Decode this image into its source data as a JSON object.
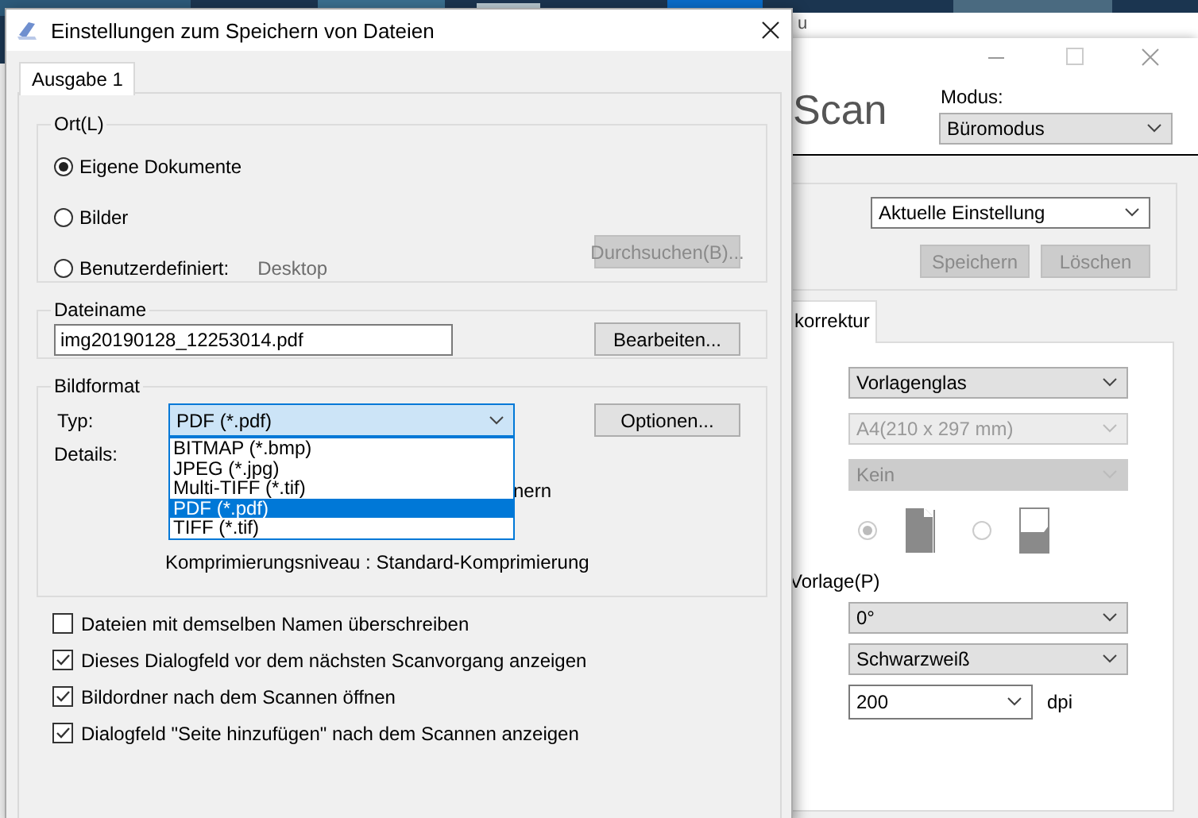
{
  "background_window": {
    "title": "u"
  },
  "dialog": {
    "title": "Einstellungen zum Speichern von Dateien",
    "tabs": [
      {
        "label": "Ausgabe 1",
        "selected": true
      }
    ],
    "location": {
      "legend": "Ort(L)",
      "options": [
        {
          "label": "Eigene Dokumente",
          "selected": true
        },
        {
          "label": "Bilder",
          "selected": false
        },
        {
          "label": "Benutzerdefiniert:",
          "selected": false,
          "value": "Desktop"
        }
      ],
      "browse_button": {
        "label": "Durchsuchen(B)...",
        "disabled": true
      }
    },
    "filename": {
      "legend": "Dateiname",
      "value": "img20190128_12253014.pdf",
      "edit_button": "Bearbeiten..."
    },
    "image_format": {
      "legend": "Bildformat",
      "type_label": "Typ:",
      "type_value": "PDF (*.pdf)",
      "options_button": "Optionen...",
      "details_label": "Details:",
      "dropdown_items": [
        {
          "label": "BITMAP (*.bmp)",
          "selected": false
        },
        {
          "label": "JPEG (*.jpg)",
          "selected": false
        },
        {
          "label": "Multi-TIFF (*.tif)",
          "selected": false
        },
        {
          "label": "PDF (*.pdf)",
          "selected": true
        },
        {
          "label": "TIFF (*.tif)",
          "selected": false
        }
      ],
      "details_lines": [
        "nern",
        "Komprimierungsniveau : Standard-Komprimierung"
      ]
    },
    "checkboxes": [
      {
        "label": "Dateien mit demselben Namen überschreiben",
        "checked": false
      },
      {
        "label": "Dieses Dialogfeld vor dem nächsten Scanvorgang anzeigen",
        "checked": true
      },
      {
        "label": "Bildordner nach dem Scannen öffnen",
        "checked": true
      },
      {
        "label": "Dialogfeld \"Seite hinzufügen\" nach dem Scannen anzeigen",
        "checked": true
      }
    ]
  },
  "scan_window": {
    "title": "Scan",
    "mode_label": "Modus:",
    "mode_value": "Büromodus",
    "preset": {
      "value": "Aktuelle Einstellung",
      "buttons": [
        {
          "label": "Speichern",
          "disabled": true
        },
        {
          "label": "Löschen",
          "disabled": true
        }
      ]
    },
    "tab": {
      "label": "korrektur",
      "selected": true
    },
    "source": {
      "value": "Vorlagenglas",
      "disabled": false
    },
    "size": {
      "value": "A4(210 x 297 mm)",
      "disabled": true
    },
    "filter": {
      "value": "Kein",
      "disabled": true
    },
    "orientation": [
      {
        "selected": true,
        "disabled": true
      },
      {
        "selected": false,
        "disabled": true
      }
    ],
    "section_label": "Vorlage(P)",
    "rotation": {
      "value": "0°",
      "disabled": false
    },
    "color_mode": {
      "value": "Schwarzweiß",
      "disabled": false
    },
    "resolution": {
      "value": "200",
      "unit": "dpi"
    }
  }
}
